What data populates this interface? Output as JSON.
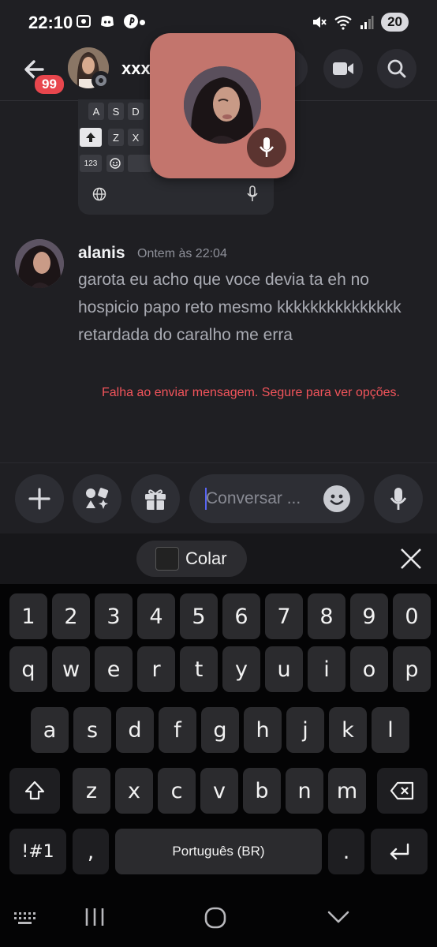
{
  "status_bar": {
    "time": "22:10",
    "battery": "20"
  },
  "header": {
    "back_badge": "99",
    "name": "xxx"
  },
  "embed_keys": [
    "A",
    "S",
    "D",
    "Z",
    "X",
    "123"
  ],
  "message": {
    "author": "alanis",
    "timestamp": "Ontem às 22:04",
    "text": "garota eu acho que voce devia ta eh no hospicio papo reto mesmo kkkkkkkkkkkkkkk retardada do caralho me erra",
    "error": "Falha ao enviar mensagem. Segure para ver opções."
  },
  "composer": {
    "placeholder": "Conversar ..."
  },
  "keyboard": {
    "paste_label": "Colar",
    "row_numbers": [
      "1",
      "2",
      "3",
      "4",
      "5",
      "6",
      "7",
      "8",
      "9",
      "0"
    ],
    "row1": [
      "q",
      "w",
      "e",
      "r",
      "t",
      "y",
      "u",
      "i",
      "o",
      "p"
    ],
    "row2": [
      "a",
      "s",
      "d",
      "f",
      "g",
      "h",
      "j",
      "k",
      "l"
    ],
    "row3": [
      "z",
      "x",
      "c",
      "v",
      "b",
      "n",
      "m"
    ],
    "symbols_key": "!#1",
    "comma_key": ",",
    "space_label": "Português (BR)",
    "period_key": "."
  },
  "colors": {
    "accent": "#5865f2",
    "error": "#f2545b",
    "badge": "#e8464d",
    "pip": "#c3756d"
  }
}
